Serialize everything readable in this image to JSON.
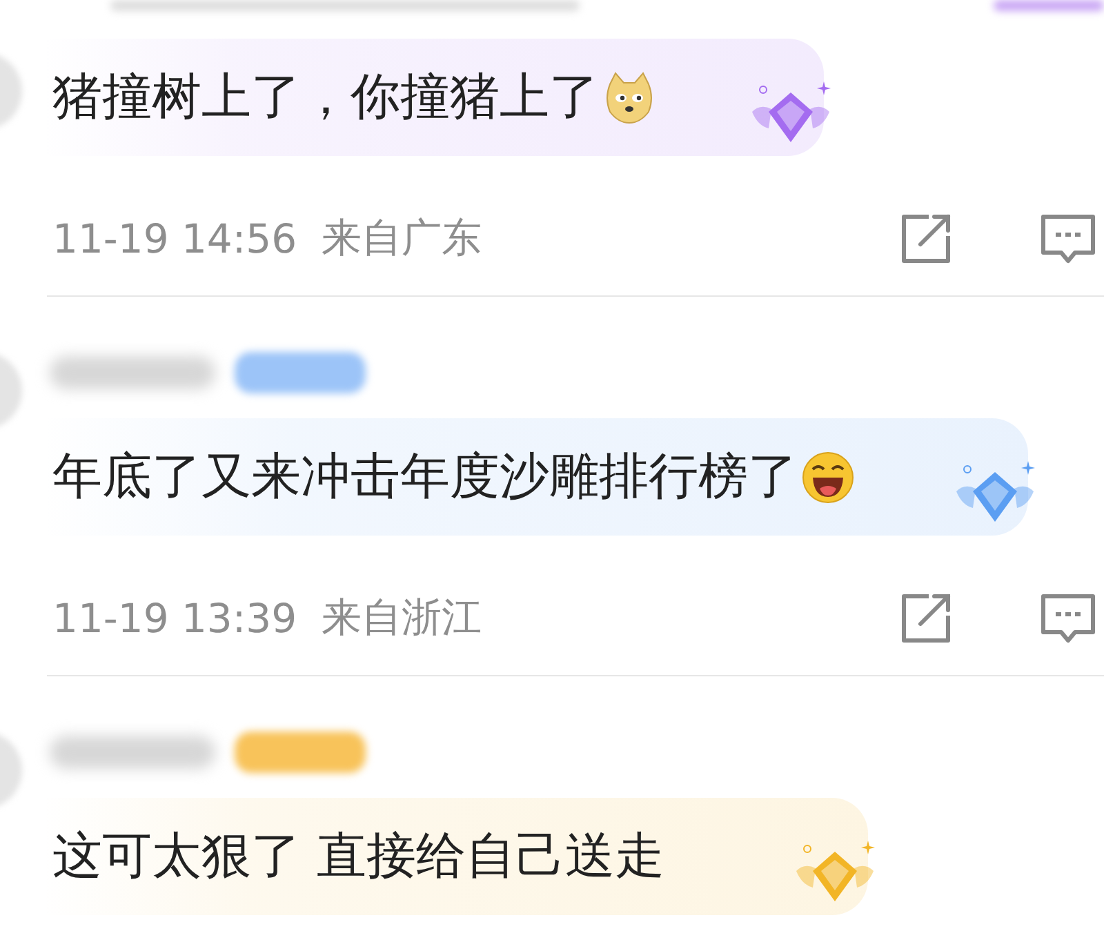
{
  "comments": [
    {
      "text": "猪撞树上了，你撞猪上了",
      "emoji": {
        "kind": "dog"
      },
      "badge": {
        "color": "#a46cf0"
      },
      "time": "11-19 14:56",
      "location": "来自广东"
    },
    {
      "tag": {
        "color": "#9cc4f8"
      },
      "text": "年底了又来冲击年度沙雕排行榜了",
      "emoji": {
        "kind": "laugh"
      },
      "badge": {
        "color": "#5b9ef2"
      },
      "time": "11-19 13:39",
      "location": "来自浙江"
    },
    {
      "tag": {
        "color": "#f8c35a"
      },
      "text": "这可太狠了 直接给自己送走",
      "badge": {
        "color": "#f2b526"
      }
    }
  ]
}
